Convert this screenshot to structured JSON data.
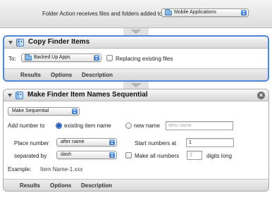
{
  "folder_action": {
    "label": "Folder Action receives files and folders added to",
    "target": "Mobile Applications"
  },
  "copy_action": {
    "title": "Copy Finder Items",
    "to_label": "To:",
    "to_value": "Backed Up Apps",
    "replace_label": "Replacing existing files",
    "replace_checked": false,
    "tabs": [
      "Results",
      "Options",
      "Description"
    ]
  },
  "rename_action": {
    "title": "Make Finder Item Names Sequential",
    "mode": "Make Sequential",
    "add_number_label": "Add number to",
    "existing_name_label": "existing item name",
    "new_name_label": "new name",
    "new_name_placeholder": "item name",
    "place_number_label": "Place number",
    "place_number_value": "after name",
    "start_numbers_label": "Start numbers at",
    "start_value": "1",
    "separated_by_label": "separated by",
    "separator_value": "dash",
    "make_all_label": "Make all numbers",
    "digits_value": "2",
    "digits_long_label": "digits long",
    "example_label": "Example:",
    "example_value": "Item Name-1.xxx",
    "tabs": [
      "Results",
      "Options",
      "Description"
    ]
  },
  "icons": {
    "disclosure": "disclosure-triangle-icon",
    "finder": "finder-icon",
    "close": "close-icon",
    "folder": "folder-icon"
  },
  "colors": {
    "selection_border": "#4e86dc",
    "popup_stepper": "#2d6cc9"
  }
}
